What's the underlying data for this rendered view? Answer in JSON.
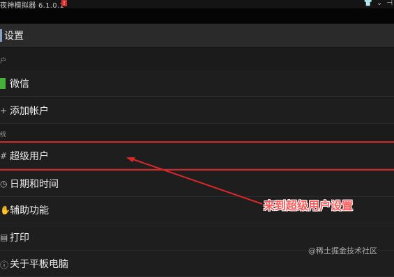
{
  "titlebar": {
    "title": "夜神模拟器 6.1.0.1",
    "badge": "!",
    "icons": [
      "shirt-icon",
      "chevron-down-icon",
      "pin-icon"
    ]
  },
  "actionbar": {
    "title": "设置"
  },
  "sections": [
    {
      "label": "户"
    },
    {
      "label": "统"
    }
  ],
  "items": [
    {
      "label": "微信",
      "icon": "wechat-icon"
    },
    {
      "label": "添加帐户",
      "icon": "add-icon"
    },
    {
      "label": "超级用户",
      "icon": "superuser-icon"
    },
    {
      "label": "日期和时间",
      "icon": "clock-icon"
    },
    {
      "label": "辅助功能",
      "icon": "accessibility-icon"
    },
    {
      "label": "打印",
      "icon": "print-icon"
    },
    {
      "label": "关于平板电脑",
      "icon": "info-icon"
    }
  ],
  "annotation": {
    "text": "来到超级用户设置",
    "color": "#d8282a"
  },
  "watermark": "@稀土掘金技术社区"
}
